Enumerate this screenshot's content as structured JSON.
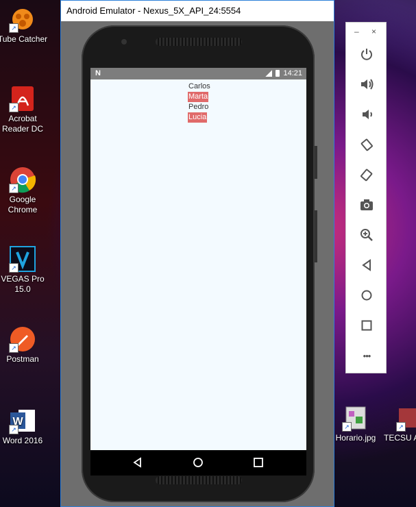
{
  "desktop": {
    "icons": [
      {
        "label": "Tube Catcher"
      },
      {
        "label": "Acrobat Reader DC"
      },
      {
        "label": "Google Chrome"
      },
      {
        "label": "VEGAS Pro 15.0"
      },
      {
        "label": "Postman"
      },
      {
        "label": "Word 2016"
      },
      {
        "label": "Horario.jpg"
      },
      {
        "label": "TECSU Acces"
      }
    ]
  },
  "emulator": {
    "title": "Android Emulator - Nexus_5X_API_24:5554",
    "status": {
      "time": "14:21",
      "left_glyph": "N"
    },
    "list": [
      {
        "name": "Carlos",
        "highlighted": false
      },
      {
        "name": "Marta",
        "highlighted": true
      },
      {
        "name": "Pedro",
        "highlighted": false
      },
      {
        "name": "Lucia",
        "highlighted": true
      }
    ],
    "highlight_color": "#e06a6a",
    "screen_bg": "#f3faff"
  },
  "toolbar": {
    "minimize": "–",
    "close": "×",
    "more": "•••"
  }
}
